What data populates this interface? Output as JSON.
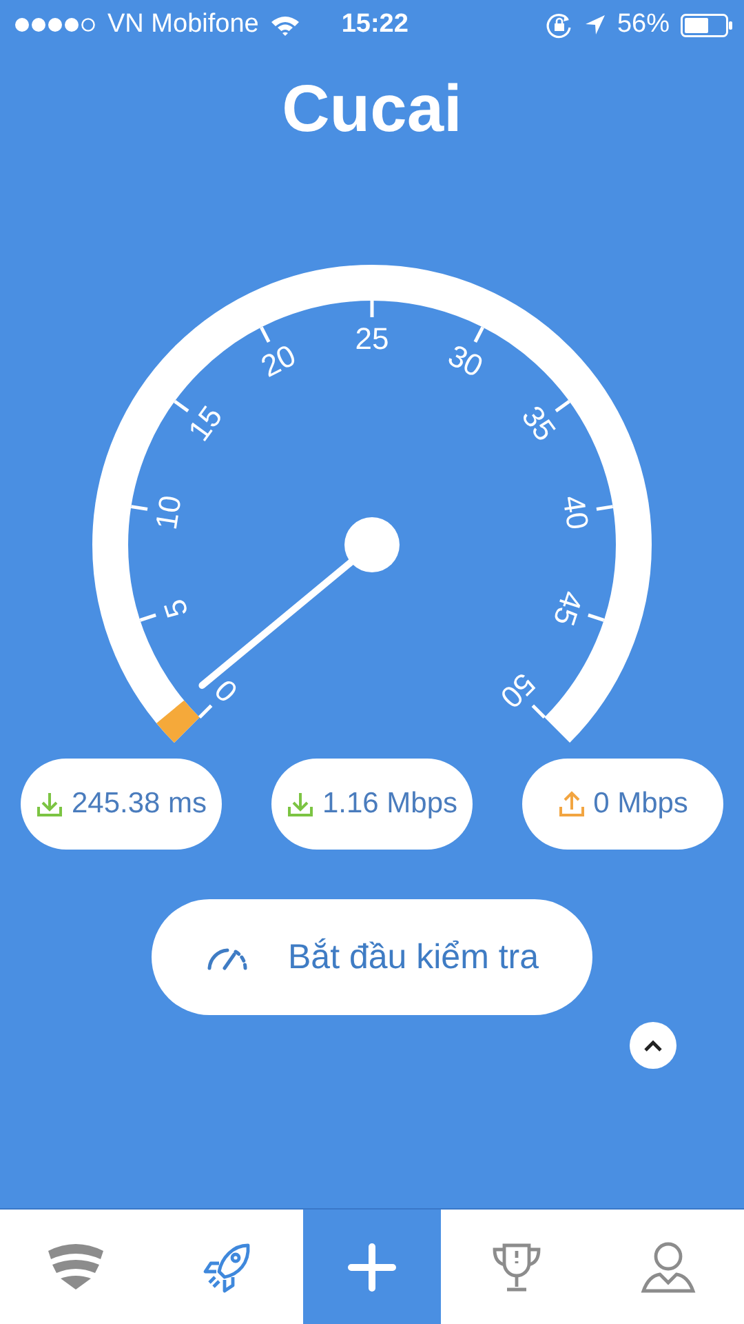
{
  "status_bar": {
    "carrier": "VN Mobifone",
    "time": "15:22",
    "battery": "56%"
  },
  "title": "Cucai",
  "gauge": {
    "labels": [
      "0",
      "5",
      "10",
      "15",
      "20",
      "25",
      "30",
      "35",
      "40",
      "45",
      "50"
    ]
  },
  "results": [
    {
      "kind": "download",
      "value": "245.38 ms"
    },
    {
      "kind": "download",
      "value": "1.16 Mbps"
    },
    {
      "kind": "upload",
      "value": "0 Mbps"
    }
  ],
  "start_button": {
    "label": "Bắt đầu kiểm tra"
  },
  "tabs": [
    {
      "kind": "wifi",
      "selected": false
    },
    {
      "kind": "rocket",
      "selected": true
    },
    {
      "kind": "add",
      "selected": false
    },
    {
      "kind": "trophy",
      "selected": false
    },
    {
      "kind": "profile",
      "selected": false
    }
  ]
}
